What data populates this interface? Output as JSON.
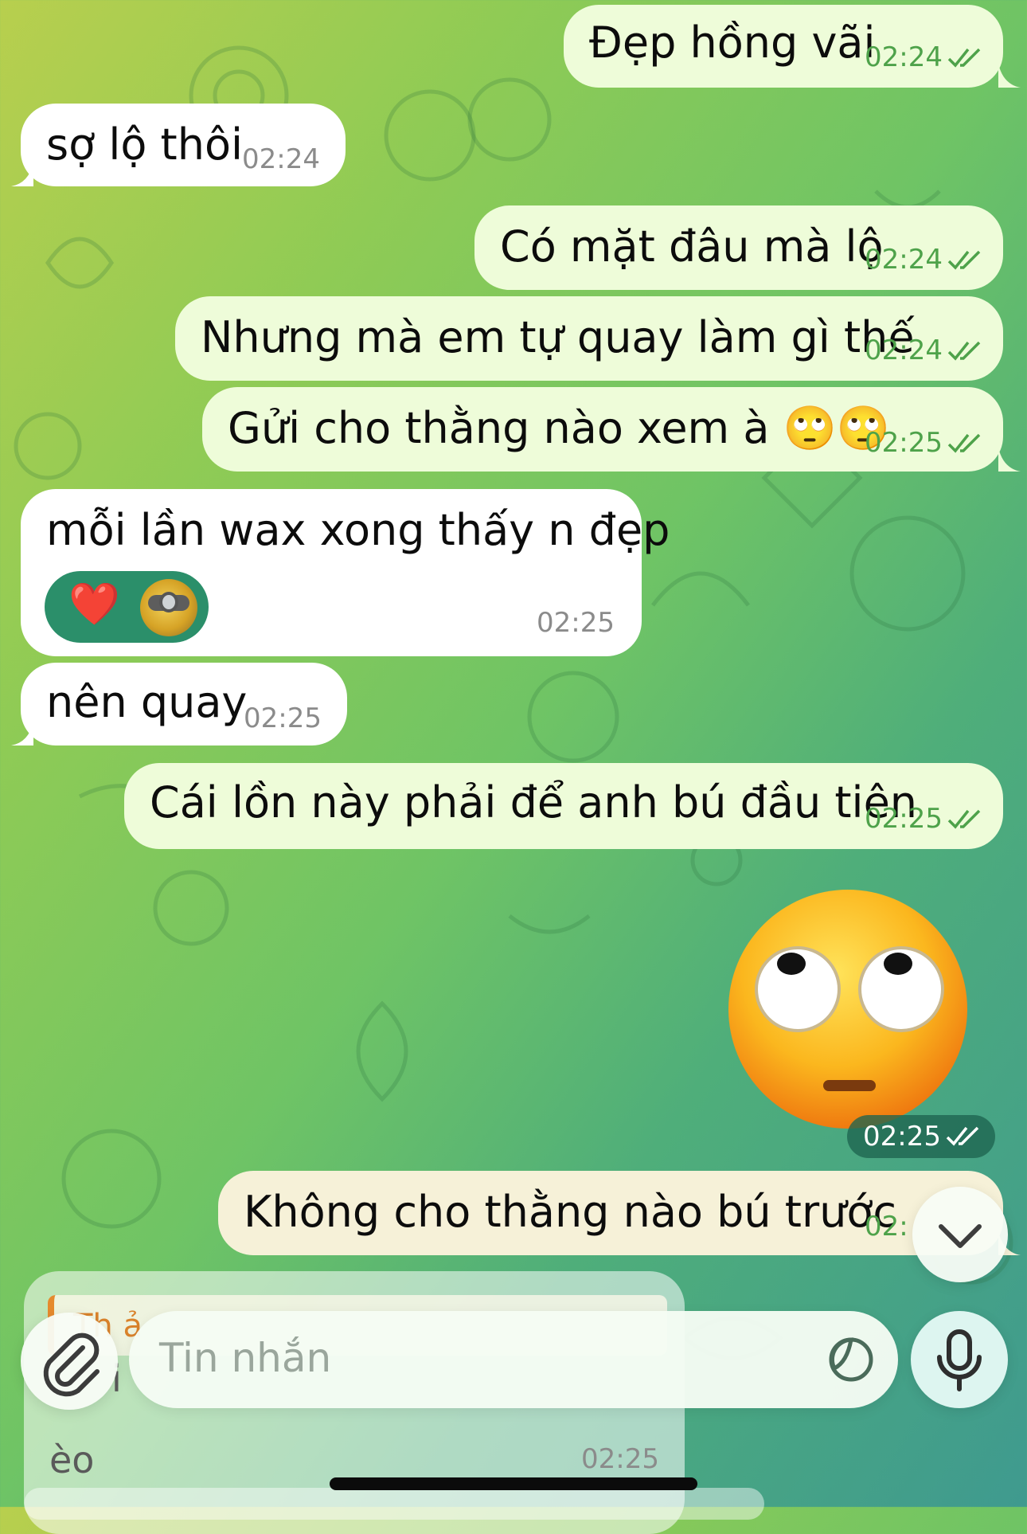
{
  "messages": [
    {
      "text": "Đẹp hồng vãi",
      "time": "02:24"
    },
    {
      "text": "sợ lộ thôi",
      "time": "02:24"
    },
    {
      "text": "Có mặt đâu mà lộ",
      "time": "02:24"
    },
    {
      "text": "Nhưng mà em tự quay làm gì thế",
      "time": "02:24"
    },
    {
      "text": "Gửi cho thằng nào xem à 🙄🙄",
      "time": "02:25"
    },
    {
      "text": "mỗi lần wax xong thấy n đẹp",
      "time": "02:25",
      "reactions": [
        "❤️"
      ]
    },
    {
      "text": "nên quay",
      "time": "02:25"
    },
    {
      "text": "Cái lồn này phải để anh bú đầu tiên",
      "time": "02:25"
    },
    {
      "sticker": "face-with-rolling-eyes-emoji",
      "time": "02:25"
    },
    {
      "text": "Không cho thằng nào bú trước",
      "time": "02:"
    },
    {
      "reply_preview": "Th ả",
      "text_fragment": "i",
      "text_end": "èo",
      "time": "02:25"
    }
  ],
  "composer": {
    "placeholder": "Tin nhắn"
  },
  "icons": {
    "attach": "paperclip-icon",
    "sticker": "sticker-icon",
    "mic": "microphone-icon",
    "scroll_down": "chevron-down-icon",
    "read": "double-check-icon"
  },
  "colors": {
    "outgoing_bubble": "#eefcd9",
    "incoming_bubble": "#ffffff",
    "time_outgoing": "#4ea24a",
    "reaction_pill": "#2b8f6a"
  }
}
